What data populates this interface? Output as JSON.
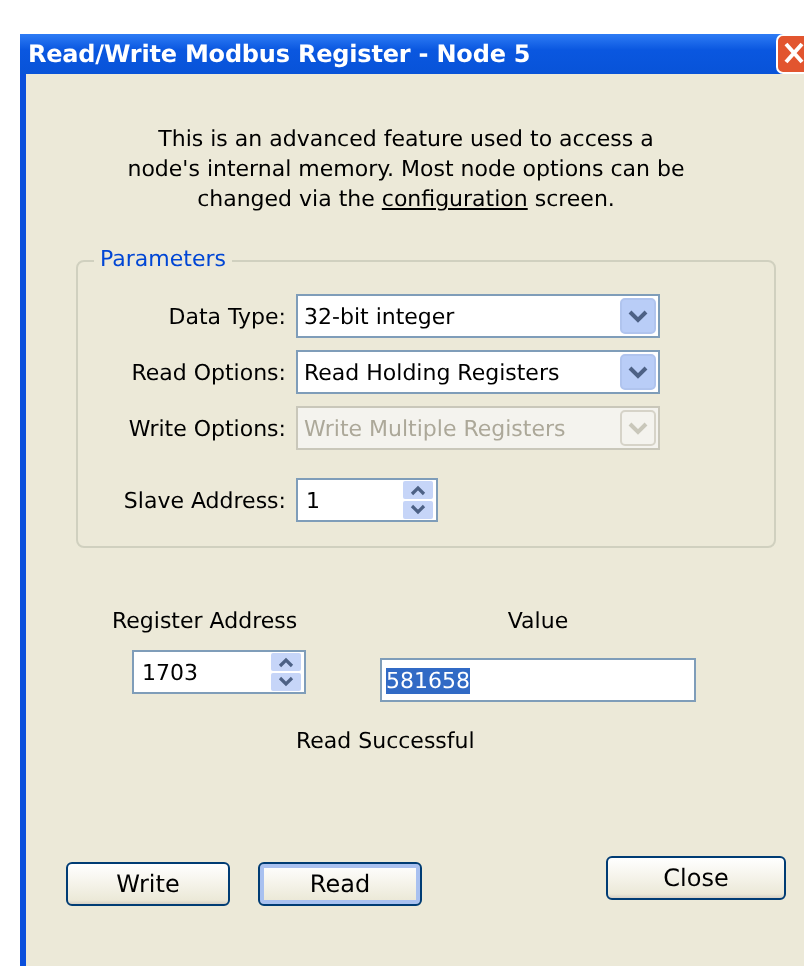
{
  "window": {
    "title": "Read/Write Modbus Register - Node 5"
  },
  "description": {
    "before": "This is an advanced feature used to access a node's internal memory. Most node options can be changed via the ",
    "link": "configuration",
    "after": " screen."
  },
  "parameters": {
    "title": "Parameters",
    "fields": [
      {
        "kind": "dropdown",
        "label": "Data Type:",
        "value": "32-bit integer",
        "disabled": false
      },
      {
        "kind": "dropdown",
        "label": "Read Options:",
        "value": "Read Holding Registers",
        "disabled": false
      },
      {
        "kind": "dropdown",
        "label": "Write Options:",
        "value": "Write Multiple Registers",
        "disabled": true
      },
      {
        "kind": "spinner",
        "label": "Slave Address:",
        "value": "1",
        "disabled": false
      }
    ]
  },
  "register": {
    "label": "Register Address",
    "value": "1703"
  },
  "value": {
    "label": "Value",
    "value": "581658",
    "text_selected": true
  },
  "status": "Read Successful",
  "buttons": [
    {
      "label": "Write",
      "focused": false
    },
    {
      "label": "Read",
      "focused": true
    },
    {
      "label": "Close",
      "focused": false
    }
  ]
}
